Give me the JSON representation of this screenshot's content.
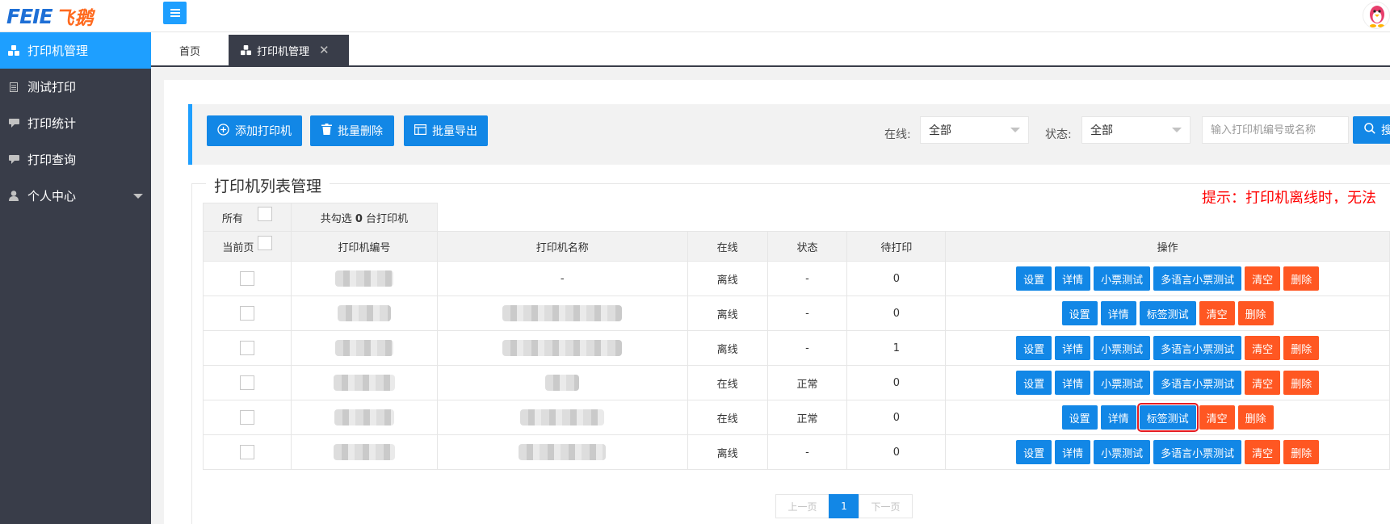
{
  "brand": {
    "logo_en": "FEIE",
    "logo_cn": "飞鹅"
  },
  "sidebar": {
    "items": [
      {
        "label": "打印机管理",
        "icon": "cubes-icon",
        "active": true
      },
      {
        "label": "测试打印",
        "icon": "document-icon"
      },
      {
        "label": "打印统计",
        "icon": "comment-icon"
      },
      {
        "label": "打印查询",
        "icon": "comment-icon"
      },
      {
        "label": "个人中心",
        "icon": "user-icon"
      }
    ]
  },
  "tabs": [
    {
      "label": "首页"
    },
    {
      "label": "打印机管理",
      "active": true
    }
  ],
  "toolbar": {
    "add_label": "添加打印机",
    "batch_delete_label": "批量删除",
    "batch_export_label": "批量导出",
    "online_label": "在线:",
    "online_value": "全部",
    "status_label": "状态:",
    "status_value": "全部",
    "search_placeholder": "输入打印机编号或名称",
    "search_button": "搜"
  },
  "section": {
    "title": "打印机列表管理",
    "hint": "提示：打印机离线时，无法"
  },
  "table": {
    "select_all_label": "所有",
    "select_page_label": "当前页",
    "selected_prefix": "共勾选 ",
    "selected_count": "0",
    "selected_suffix": " 台打印机",
    "headers": {
      "sn": "打印机编号",
      "name": "打印机名称",
      "online": "在线",
      "status": "状态",
      "pending": "待打印",
      "ops": "操作"
    },
    "ops_labels": {
      "settings": "设置",
      "details": "详情",
      "receipt_test": "小票测试",
      "multilang_test": "多语言小票测试",
      "label_test": "标签测试",
      "clear": "清空",
      "delete": "删除"
    },
    "rows": [
      {
        "name": "-",
        "online": "离线",
        "status": "-",
        "pending": "0",
        "type": "receipt"
      },
      {
        "name": "",
        "online": "离线",
        "status": "-",
        "pending": "0",
        "type": "label"
      },
      {
        "name": "",
        "online": "离线",
        "status": "-",
        "pending": "1",
        "type": "receipt"
      },
      {
        "name": "",
        "online": "在线",
        "status": "正常",
        "pending": "0",
        "type": "receipt"
      },
      {
        "name": "",
        "online": "在线",
        "status": "正常",
        "pending": "0",
        "type": "label"
      },
      {
        "name": "",
        "online": "离线",
        "status": "-",
        "pending": "0",
        "type": "receipt"
      }
    ]
  },
  "pager": {
    "prev": "上一页",
    "current": "1",
    "next": "下一页"
  },
  "colors": {
    "primary": "#1287e6",
    "danger": "#ff5722",
    "sidebar": "#393d49",
    "offline": "#ff0000",
    "online": "#009900"
  }
}
